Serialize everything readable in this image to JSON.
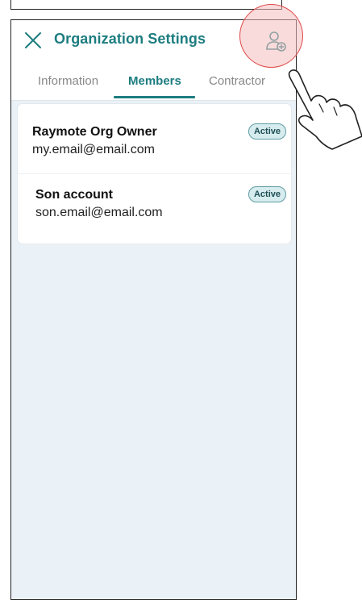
{
  "header": {
    "title": "Organization Settings"
  },
  "tabs": [
    {
      "label": "Information",
      "active": false
    },
    {
      "label": "Members",
      "active": true
    },
    {
      "label": "Contractor",
      "active": false
    }
  ],
  "members": [
    {
      "name": "Raymote Org Owner",
      "email": "my.email@email.com",
      "status": "Active"
    },
    {
      "name": "Son account",
      "email": "son.email@email.com",
      "status": "Active"
    }
  ],
  "icons": {
    "close": "close-icon",
    "add_user": "add-user-icon",
    "pointer": "pointing-hand-icon"
  },
  "colors": {
    "accent": "#1d7d80",
    "badge_bg": "#d7ecee",
    "badge_border": "#5f9ca3",
    "page_bg": "#eaf2f8",
    "tap_highlight": "#e04848"
  }
}
